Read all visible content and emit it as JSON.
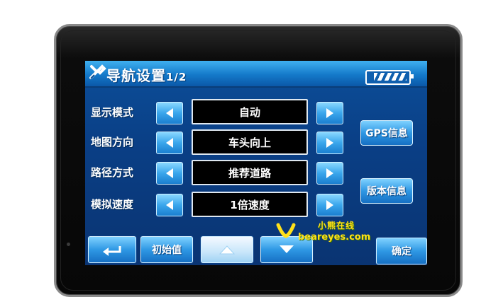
{
  "header": {
    "title": "导航设置",
    "page": "1/2"
  },
  "rows": [
    {
      "label": "显示模式",
      "value": "自动"
    },
    {
      "label": "地图方向",
      "value": "车头向上"
    },
    {
      "label": "路径方式",
      "value": "推荐道路"
    },
    {
      "label": "模拟速度",
      "value": "1倍速度"
    }
  ],
  "side_buttons": {
    "gps": "GPS信息",
    "version": "版本信息"
  },
  "bottom_bar": {
    "reset": "初始值",
    "confirm": "确定"
  },
  "watermark": {
    "top": "小熊在线",
    "bottom": "beareyes.com"
  },
  "icons": {
    "title": "wrench-icon",
    "battery": "battery-icon",
    "back": "return-arrow-icon",
    "up": "arrow-up-icon",
    "down": "arrow-down-icon",
    "left": "arrow-left-icon",
    "right": "arrow-right-icon"
  },
  "colors": {
    "screen_bg": "#0a3f86",
    "title_bar": "#1479c9",
    "button": "#2f98e4",
    "value_box": "#000000",
    "watermark": "#ffe11a"
  }
}
